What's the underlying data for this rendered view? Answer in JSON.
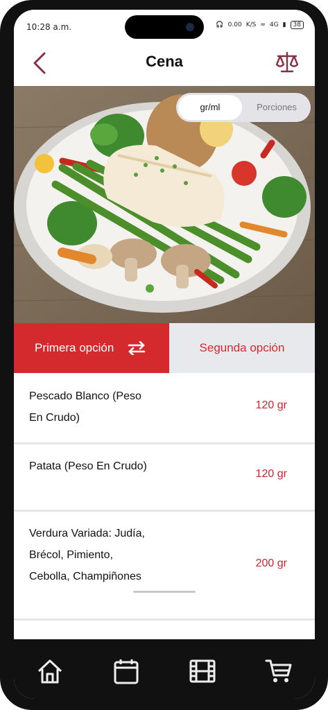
{
  "status_bar": {
    "time": "10:28 a.m.",
    "speed_value": "0.00",
    "speed_unit": "K/S",
    "network": "4G",
    "battery": "38"
  },
  "header": {
    "title": "Cena"
  },
  "unit_toggle": {
    "active": "gr/ml",
    "inactive": "Porciones"
  },
  "options": {
    "first": "Primera opción",
    "second": "Segunda opción"
  },
  "foods": [
    {
      "name": "Pescado Blanco (Peso En Crudo)",
      "qty": "120 gr"
    },
    {
      "name": "Patata (Peso En Crudo)",
      "qty": "120 gr"
    },
    {
      "name": "Verdura Variada: Judía, Brécol, Pimiento, Cebolla, Champiñones",
      "qty": "200 gr"
    }
  ],
  "icons": {
    "back": "chevron-left-icon",
    "scale": "balance-scale-icon",
    "swap": "swap-arrows-icon",
    "nav": [
      "home-icon",
      "calendar-icon",
      "film-icon",
      "cart-icon"
    ]
  },
  "colors": {
    "accent": "#d42a2e",
    "icon_accent": "#8a2e44",
    "nav_bg": "#111111"
  }
}
